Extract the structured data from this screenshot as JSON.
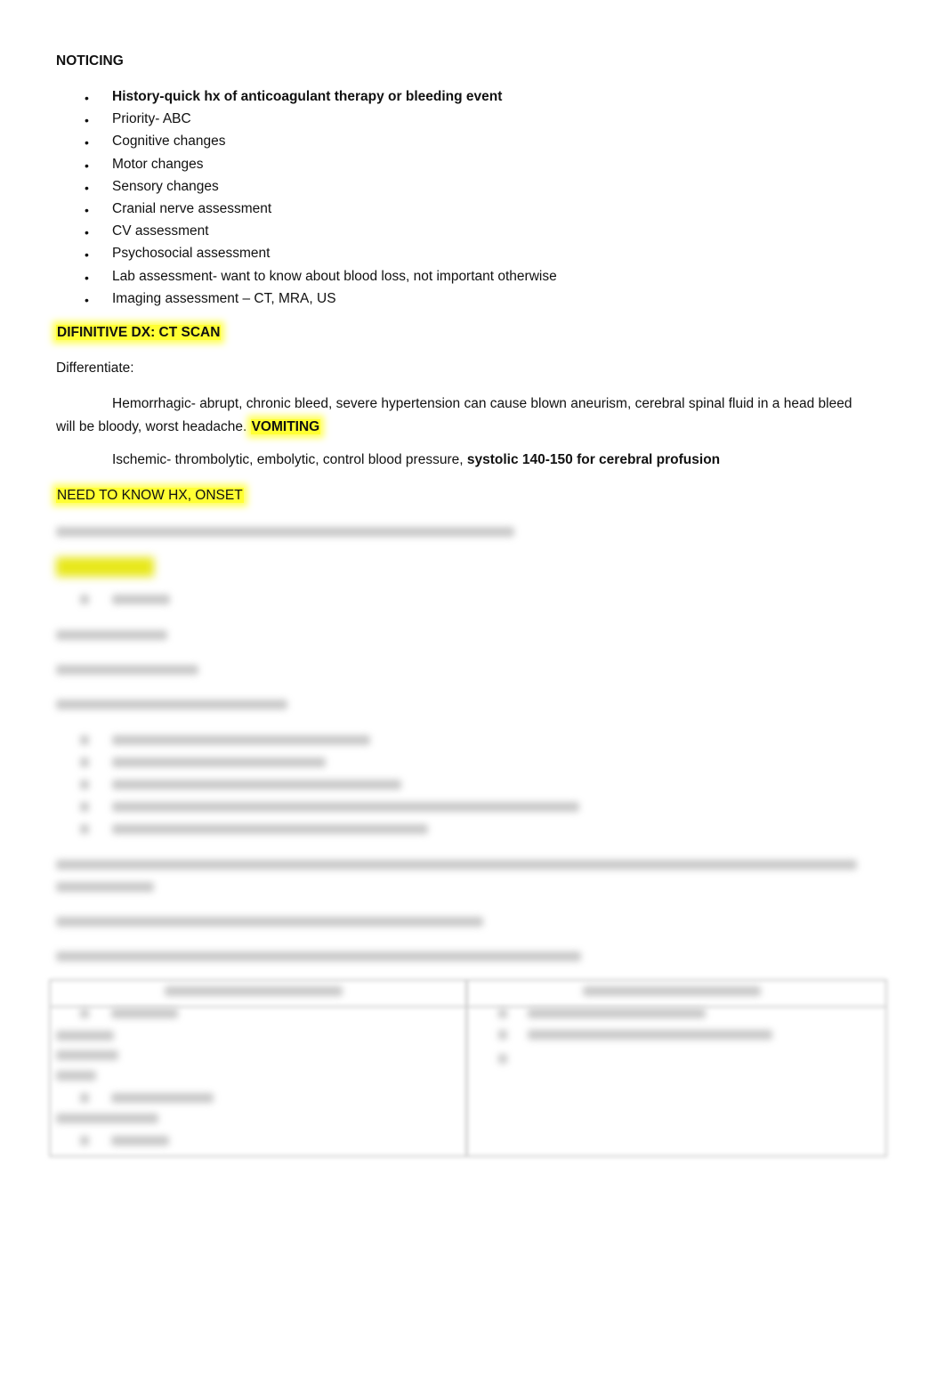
{
  "heading": "NOTICING",
  "bullets": [
    {
      "text": "History-quick hx of anticoagulant therapy or bleeding event",
      "bold": true
    },
    {
      "text": "Priority- ABC"
    },
    {
      "text": "Cognitive changes"
    },
    {
      "text": "Motor changes"
    },
    {
      "text": "Sensory changes"
    },
    {
      "text": "Cranial nerve assessment"
    },
    {
      "text": "CV assessment"
    },
    {
      "text": "Psychosocial assessment"
    },
    {
      "text": "Lab assessment- want to know about blood loss, not important otherwise"
    },
    {
      "text": "Imaging assessment – CT, MRA, US"
    }
  ],
  "bullet_glyph": "•",
  "definitive_dx": "DIFINITIVE DX: CT SCAN",
  "differentiate_label": "Differentiate:",
  "hemorrhagic_text": "Hemorrhagic- abrupt, chronic bleed, severe hypertension can cause blown aneurism, cerebral spinal fluid in a head bleed will be bloody, worst headache.",
  "hemorrhagic_emphasis": "VOMITING",
  "ischemic_text": "Ischemic- thrombolytic, embolytic, control blood pressure,",
  "ischemic_emphasis": "systolic 140-150 for cerebral profusion",
  "need_to_know": "NEED TO KNOW HX, ONSET",
  "highlight_color": "#ffff33"
}
